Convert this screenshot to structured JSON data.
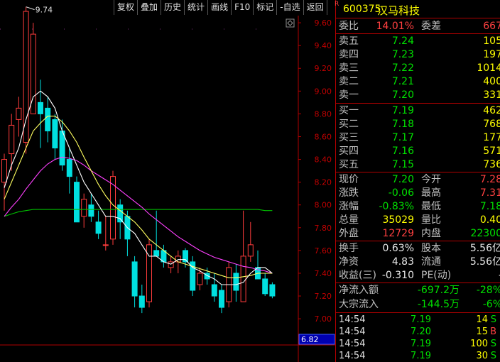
{
  "toolbar": {
    "buttons": [
      "复权",
      "叠加",
      "历史",
      "统计",
      "画线",
      "F10",
      "标记",
      "-自选",
      "返回"
    ]
  },
  "chart_data": {
    "type": "candlestick",
    "ylim": [
      6.77,
      9.8
    ],
    "y_ticks": [
      "9.60",
      "9.40",
      "9.20",
      "9.00",
      "8.80",
      "8.60",
      "8.40",
      "8.20",
      "8.00",
      "7.80",
      "7.60",
      "7.40",
      "7.20",
      "7.00",
      "6.80"
    ],
    "max_label": "9.74",
    "max_price": 9.74,
    "price_marker": "6.82",
    "price_marker_value": 6.82,
    "candles": [
      {
        "o": 8.2,
        "h": 8.45,
        "l": 7.95,
        "c": 8.4
      },
      {
        "o": 8.45,
        "h": 8.8,
        "l": 8.3,
        "c": 8.7
      },
      {
        "o": 8.75,
        "h": 8.95,
        "l": 8.6,
        "c": 8.85
      },
      {
        "o": 8.55,
        "h": 9.74,
        "l": 8.45,
        "c": 9.7
      },
      {
        "o": 8.8,
        "h": 9.6,
        "l": 8.8,
        "c": 9.5
      },
      {
        "o": 8.9,
        "h": 9.1,
        "l": 8.5,
        "c": 8.8
      },
      {
        "o": 8.85,
        "h": 8.95,
        "l": 8.55,
        "c": 8.65
      },
      {
        "o": 8.75,
        "h": 8.8,
        "l": 8.4,
        "c": 8.5
      },
      {
        "o": 8.65,
        "h": 8.75,
        "l": 8.3,
        "c": 8.35
      },
      {
        "o": 8.4,
        "h": 8.5,
        "l": 8.1,
        "c": 8.25
      },
      {
        "o": 8.2,
        "h": 8.25,
        "l": 7.85,
        "c": 7.85
      },
      {
        "o": 7.9,
        "h": 8.1,
        "l": 7.8,
        "c": 8.05
      },
      {
        "o": 8.0,
        "h": 8.1,
        "l": 7.85,
        "c": 7.9
      },
      {
        "o": 7.85,
        "h": 7.95,
        "l": 7.7,
        "c": 7.75
      },
      {
        "o": 7.65,
        "h": 7.9,
        "l": 7.6,
        "c": 7.65
      },
      {
        "o": 7.7,
        "h": 8.3,
        "l": 7.65,
        "c": 8.25
      },
      {
        "o": 8.0,
        "h": 8.05,
        "l": 7.7,
        "c": 7.85
      },
      {
        "o": 7.9,
        "h": 7.95,
        "l": 7.55,
        "c": 7.7
      },
      {
        "o": 7.5,
        "h": 7.55,
        "l": 7.1,
        "c": 7.2
      },
      {
        "o": 7.2,
        "h": 7.3,
        "l": 7.05,
        "c": 7.1
      },
      {
        "o": 7.15,
        "h": 7.7,
        "l": 7.1,
        "c": 7.65
      },
      {
        "o": 7.6,
        "h": 7.95,
        "l": 7.55,
        "c": 7.55
      },
      {
        "o": 7.6,
        "h": 7.65,
        "l": 7.45,
        "c": 7.5
      },
      {
        "o": 7.45,
        "h": 7.55,
        "l": 7.4,
        "c": 7.5
      },
      {
        "o": 7.5,
        "h": 7.6,
        "l": 7.4,
        "c": 7.55
      },
      {
        "o": 7.6,
        "h": 7.62,
        "l": 7.45,
        "c": 7.5
      },
      {
        "o": 7.5,
        "h": 7.55,
        "l": 7.2,
        "c": 7.25
      },
      {
        "o": 7.3,
        "h": 7.45,
        "l": 7.25,
        "c": 7.4
      },
      {
        "o": 7.4,
        "h": 7.45,
        "l": 7.3,
        "c": 7.35
      },
      {
        "o": 7.3,
        "h": 7.4,
        "l": 7.15,
        "c": 7.2
      },
      {
        "o": 7.25,
        "h": 7.3,
        "l": 7.05,
        "c": 7.1
      },
      {
        "o": 7.15,
        "h": 7.5,
        "l": 7.1,
        "c": 7.45
      },
      {
        "o": 7.4,
        "h": 7.48,
        "l": 7.15,
        "c": 7.25
      },
      {
        "o": 7.15,
        "h": 7.95,
        "l": 7.15,
        "c": 7.55
      },
      {
        "o": 7.55,
        "h": 7.85,
        "l": 7.5,
        "c": 7.65
      },
      {
        "o": 7.45,
        "h": 7.6,
        "l": 7.35,
        "c": 7.35
      },
      {
        "o": 7.35,
        "h": 7.4,
        "l": 7.2,
        "c": 7.22
      },
      {
        "o": 7.3,
        "h": 7.32,
        "l": 7.18,
        "c": 7.2
      }
    ],
    "ma5": [
      8.15,
      8.35,
      8.5,
      8.75,
      8.95,
      9.0,
      8.95,
      8.85,
      8.65,
      8.5,
      8.35,
      8.2,
      8.1,
      8.0,
      7.9,
      7.9,
      7.88,
      7.8,
      7.75,
      7.65,
      7.55,
      7.55,
      7.5,
      7.48,
      7.52,
      7.52,
      7.45,
      7.42,
      7.38,
      7.35,
      7.3,
      7.3,
      7.3,
      7.32,
      7.4,
      7.45,
      7.45,
      7.4
    ],
    "ma10": [
      8.05,
      8.2,
      8.35,
      8.5,
      8.65,
      8.72,
      8.78,
      8.78,
      8.73,
      8.65,
      8.55,
      8.42,
      8.3,
      8.18,
      8.08,
      8.0,
      7.95,
      7.9,
      7.85,
      7.78,
      7.7,
      7.65,
      7.6,
      7.55,
      7.5,
      7.48,
      7.46,
      7.44,
      7.42,
      7.4,
      7.38,
      7.36,
      7.36,
      7.37,
      7.38,
      7.4,
      7.4,
      7.4
    ],
    "ma20": [
      7.9,
      7.98,
      8.05,
      8.14,
      8.22,
      8.3,
      8.36,
      8.4,
      8.42,
      8.41,
      8.39,
      8.35,
      8.3,
      8.26,
      8.22,
      8.18,
      8.13,
      8.08,
      8.03,
      7.98,
      7.92,
      7.87,
      7.82,
      7.77,
      7.72,
      7.68,
      7.64,
      7.6,
      7.57,
      7.54,
      7.52,
      7.5,
      7.48,
      7.46,
      7.45,
      7.43,
      7.42,
      7.4
    ],
    "ma60": [
      7.9,
      7.92,
      7.94,
      7.95,
      7.96,
      7.96,
      7.96,
      7.96,
      7.96,
      7.96,
      7.96,
      7.96,
      7.96,
      7.96,
      7.96,
      7.96,
      7.96,
      7.96,
      7.96,
      7.96,
      7.96,
      7.96,
      7.96,
      7.96,
      7.96,
      7.96,
      7.96,
      7.96,
      7.96,
      7.96,
      7.96,
      7.96,
      7.96,
      7.96,
      7.96,
      7.96,
      7.95,
      7.95
    ],
    "colors": {
      "up": "#ff3c3c",
      "down": "#00e0e0",
      "ma5": "#ffffff",
      "ma10": "#ffff60",
      "ma20": "#ff40ff",
      "ma60": "#00c000",
      "axis": "#b00000",
      "text": "#c00000"
    }
  },
  "stock": {
    "r": "R",
    "code": "600375",
    "name": "汉马科技"
  },
  "wei": {
    "label": "委比",
    "value": "14.01%",
    "label2": "委差",
    "value2": "667"
  },
  "sells": [
    {
      "label": "卖五",
      "price": "7.24",
      "vol": "105"
    },
    {
      "label": "卖四",
      "price": "7.23",
      "vol": "197"
    },
    {
      "label": "卖三",
      "price": "7.22",
      "vol": "1014"
    },
    {
      "label": "卖二",
      "price": "7.21",
      "vol": "400"
    },
    {
      "label": "卖一",
      "price": "7.20",
      "vol": "331"
    }
  ],
  "buys": [
    {
      "label": "买一",
      "price": "7.19",
      "vol": "462"
    },
    {
      "label": "买二",
      "price": "7.18",
      "vol": "768"
    },
    {
      "label": "买三",
      "price": "7.17",
      "vol": "177"
    },
    {
      "label": "买四",
      "price": "7.16",
      "vol": "571"
    },
    {
      "label": "买五",
      "price": "7.15",
      "vol": "736"
    }
  ],
  "quote": [
    {
      "l1": "现价",
      "v1": "7.20",
      "l2": "今开",
      "v2": "7.28"
    },
    {
      "l1": "涨跌",
      "v1": "-0.06",
      "l2": "最高",
      "v2": "7.31"
    },
    {
      "l1": "涨幅",
      "v1": "-0.83%",
      "l2": "最低",
      "v2": "7.18"
    },
    {
      "l1": "总量",
      "v1": "35029",
      "l2": "量比",
      "v2": "0.40"
    },
    {
      "l1": "外盘",
      "v1": "12729",
      "l2": "内盘",
      "v2": "22300"
    }
  ],
  "stats": [
    {
      "l1": "换手",
      "v1": "0.63%",
      "l2": "股本",
      "v2": "5.56亿"
    },
    {
      "l1": "净资",
      "v1": "4.83",
      "l2": "流通",
      "v2": "5.56亿"
    },
    {
      "l1": "收益(三)",
      "v1": "-0.310",
      "l2": "PE(动)",
      "v2": "-"
    }
  ],
  "flows": [
    {
      "label": "净流入额",
      "value": "-697.2万",
      "pct": "-28%"
    },
    {
      "label": "大宗流入",
      "value": "-144.5万",
      "pct": "-6%"
    }
  ],
  "ticks": [
    {
      "time": "14:54",
      "price": "7.19",
      "vol": "14",
      "dir": "S"
    },
    {
      "time": "14:54",
      "price": "7.20",
      "vol": "15",
      "dir": "B"
    },
    {
      "time": "14:54",
      "price": "7.19",
      "vol": "100",
      "dir": "S"
    },
    {
      "time": "14:54",
      "price": "7.19",
      "vol": "30",
      "dir": "S"
    }
  ]
}
